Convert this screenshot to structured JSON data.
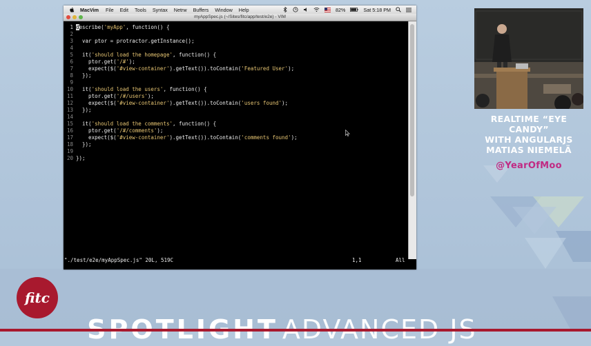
{
  "menubar": {
    "app_name": "MacVim",
    "items": [
      "File",
      "Edit",
      "Tools",
      "Syntax",
      "Netrw",
      "Buffers",
      "Window",
      "Help"
    ],
    "battery": "82%",
    "clock": "Sat 5:18 PM"
  },
  "window": {
    "title": "myAppSpec.js (~/Sites/fitc/app/test/e2e) - VIM"
  },
  "editor": {
    "lines": [
      {
        "n": "1",
        "t": "describe('myApp', function() {"
      },
      {
        "n": "2",
        "t": ""
      },
      {
        "n": "3",
        "t": "  var ptor = protractor.getInstance();"
      },
      {
        "n": "4",
        "t": ""
      },
      {
        "n": "5",
        "t": "  it('should load the homepage', function() {"
      },
      {
        "n": "6",
        "t": "    ptor.get('/#');"
      },
      {
        "n": "7",
        "t": "    expect($('#view-container').getText()).toContain('Featured User');"
      },
      {
        "n": "8",
        "t": "  });"
      },
      {
        "n": "9",
        "t": ""
      },
      {
        "n": "10",
        "t": "  it('should load the users', function() {"
      },
      {
        "n": "11",
        "t": "    ptor.get('/#/users');"
      },
      {
        "n": "12",
        "t": "    expect($('#view-container').getText()).toContain('users found');"
      },
      {
        "n": "13",
        "t": "  });"
      },
      {
        "n": "14",
        "t": ""
      },
      {
        "n": "15",
        "t": "  it('should load the comments', function() {"
      },
      {
        "n": "16",
        "t": "    ptor.get('/#/comments');"
      },
      {
        "n": "17",
        "t": "    expect($('#view-container').getText()).toContain('comments found');"
      },
      {
        "n": "18",
        "t": "  });"
      },
      {
        "n": "19",
        "t": ""
      },
      {
        "n": "20",
        "t": "});"
      }
    ],
    "status_file": "\"./test/e2e/myAppSpec.js\" 20L, 519C",
    "status_pos": "1,1",
    "status_scroll": "All"
  },
  "talk": {
    "title_line1": "REALTIME “EYE CANDY”",
    "title_line2": "WITH ANGULARJS",
    "speaker": "MATIAS NIEMELÄ",
    "handle": "@YearOfMoo"
  },
  "branding": {
    "logo_text": "fitc",
    "title_bold": "SPOTLIGHT",
    "title_light": "ADVANCED JS"
  },
  "colors": {
    "accent_red": "#a8192e",
    "handle_magenta": "#c12a83",
    "background": "#b4c8dc",
    "string_yellow": "#e8c673"
  }
}
